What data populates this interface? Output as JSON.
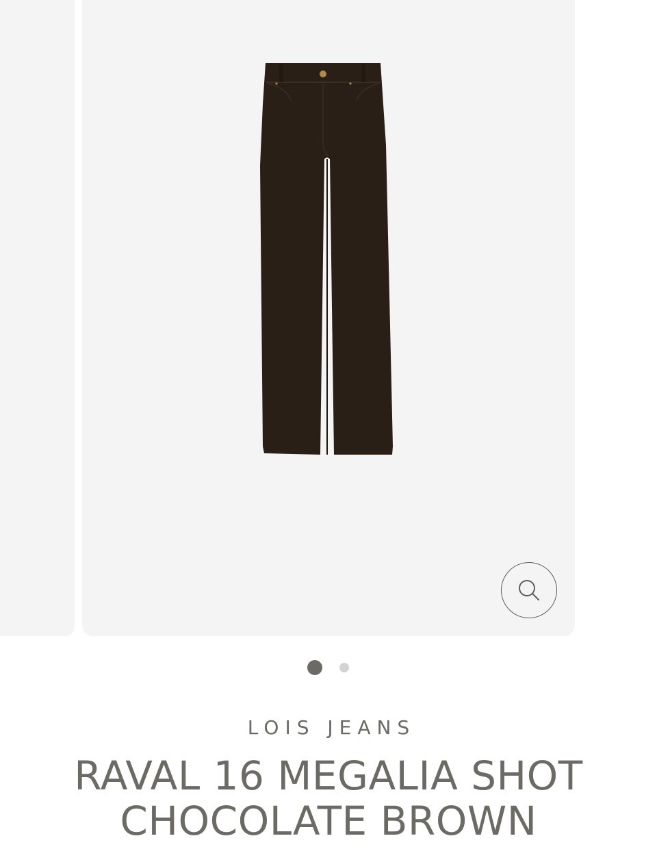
{
  "gallery": {
    "image_subject": "chocolate-brown-wide-leg-jeans",
    "zoom_icon": "search-icon",
    "slide_count": 2,
    "active_slide": 1
  },
  "product": {
    "brand": "LOIS JEANS",
    "title": "RAVAL 16 MEGALIA SHOT CHOCOLATE BROWN"
  },
  "colors": {
    "background": "#ffffff",
    "image_background": "#f4f4f4",
    "text": "#6b6a64",
    "dot_active": "#6b6a64",
    "dot_inactive": "#d3d3d3",
    "product": "#2a1f17"
  }
}
